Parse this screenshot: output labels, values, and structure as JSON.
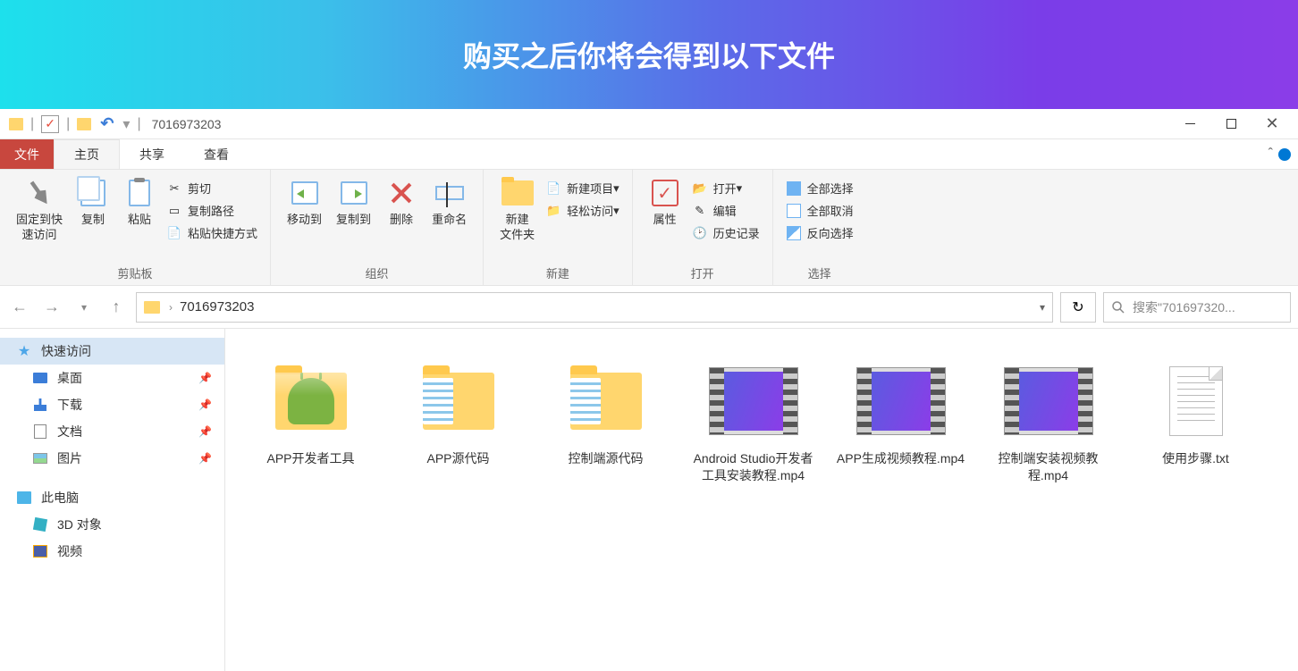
{
  "banner": {
    "title": "购买之后你将会得到以下文件"
  },
  "title_bar": {
    "title": "7016973203"
  },
  "ribbon_tabs": {
    "file": "文件",
    "home": "主页",
    "share": "共享",
    "view": "查看"
  },
  "ribbon": {
    "clipboard": {
      "label": "剪贴板",
      "pin": "固定到快\n速访问",
      "copy": "复制",
      "paste": "粘贴",
      "cut": "剪切",
      "copy_path": "复制路径",
      "paste_shortcut": "粘贴快捷方式"
    },
    "organize": {
      "label": "组织",
      "move_to": "移动到",
      "copy_to": "复制到",
      "delete": "删除",
      "rename": "重命名"
    },
    "new": {
      "label": "新建",
      "new_folder": "新建\n文件夹",
      "new_item": "新建项目",
      "easy_access": "轻松访问"
    },
    "open": {
      "label": "打开",
      "properties": "属性",
      "open": "打开",
      "edit": "编辑",
      "history": "历史记录"
    },
    "select": {
      "label": "选择",
      "select_all": "全部选择",
      "select_none": "全部取消",
      "invert": "反向选择"
    }
  },
  "address": {
    "path": "7016973203",
    "search_placeholder": "搜索\"701697320..."
  },
  "sidebar": {
    "quick_access": "快速访问",
    "desktop": "桌面",
    "downloads": "下载",
    "documents": "文档",
    "pictures": "图片",
    "this_pc": "此电脑",
    "objects_3d": "3D 对象",
    "videos": "视频"
  },
  "files": [
    {
      "name": "APP开发者工具",
      "type": "folder-app"
    },
    {
      "name": "APP源代码",
      "type": "folder-docs"
    },
    {
      "name": "控制端源代码",
      "type": "folder-docs"
    },
    {
      "name": "Android Studio开发者工具安装教程.mp4",
      "type": "video"
    },
    {
      "name": "APP生成视频教程.mp4",
      "type": "video"
    },
    {
      "name": "控制端安装视频教程.mp4",
      "type": "video"
    },
    {
      "name": "使用步骤.txt",
      "type": "txt"
    }
  ]
}
